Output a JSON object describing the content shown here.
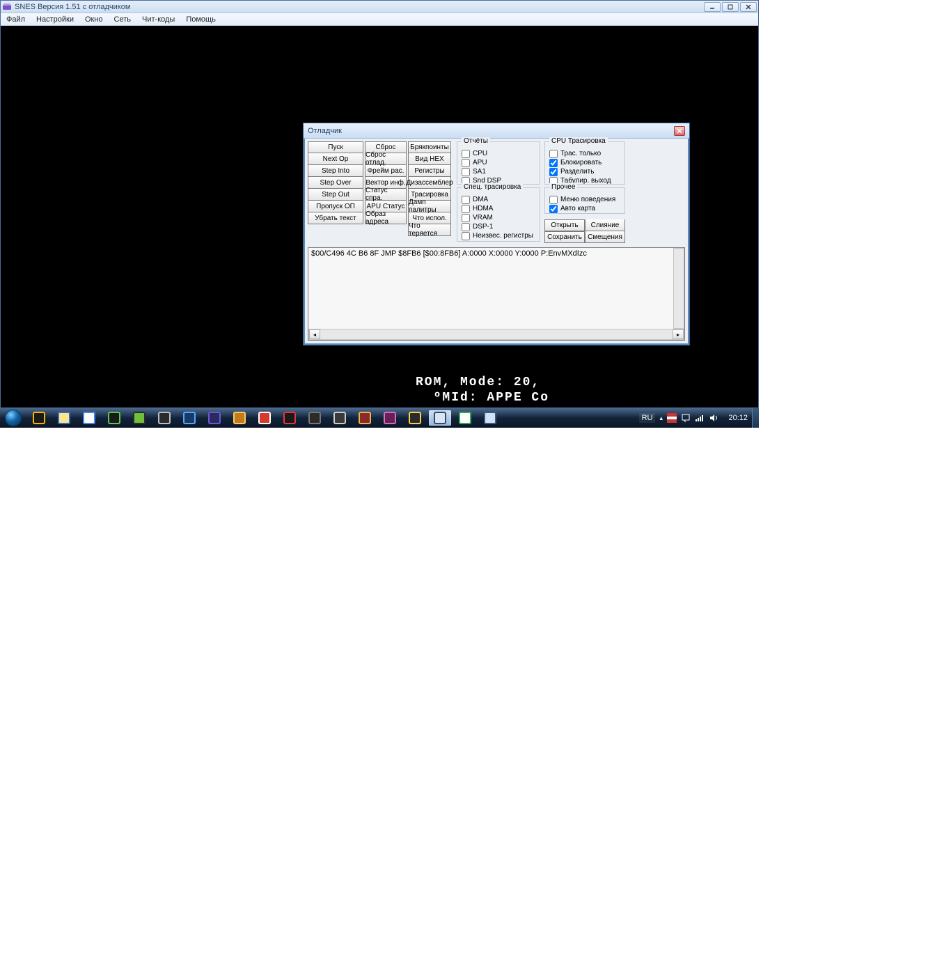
{
  "app": {
    "title": "SNES Версия 1.51 с отладчиком",
    "menu": [
      "Файл",
      "Настройки",
      "Окно",
      "Сеть",
      "Чит-коды",
      "Помощь"
    ]
  },
  "rom_overlay": "ROM, Mode: 20,\n  ºMId: APPE Co",
  "debugger": {
    "title": "Отладчик",
    "col1": [
      "Пуск",
      "Next Op",
      "Step Into",
      "Step Over",
      "Step Out",
      "Пропуск ОП",
      "Убрать текст"
    ],
    "col2": [
      "Сброс",
      "Сброс отлад.",
      "Фрейм рас.",
      "Вектор инф.",
      "Статус спра.",
      "APU Статус",
      "Образ адреса"
    ],
    "col3": [
      "Брякпоинты",
      "Вид HEX",
      "Регистры",
      "Дизассемблер",
      "Трасировка",
      "Дамп палитры",
      "Что испол.",
      "Что теряется"
    ],
    "groups": {
      "reports": {
        "legend": "Отчёты",
        "items": [
          {
            "label": "CPU",
            "checked": false
          },
          {
            "label": "APU",
            "checked": false
          },
          {
            "label": "SA1",
            "checked": false
          },
          {
            "label": "Snd DSP",
            "checked": false
          }
        ]
      },
      "spec": {
        "legend": "Спец. трасировка",
        "items": [
          {
            "label": "DMA",
            "checked": false
          },
          {
            "label": "HDMA",
            "checked": false
          },
          {
            "label": "VRAM",
            "checked": false
          },
          {
            "label": "DSP-1",
            "checked": false
          },
          {
            "label": "Неизвес. регистры",
            "checked": false
          }
        ]
      },
      "cpu": {
        "legend": "CPU Трасировка",
        "items": [
          {
            "label": "Трас. только",
            "checked": false
          },
          {
            "label": "Блокировать",
            "checked": true
          },
          {
            "label": "Разделить",
            "checked": true
          },
          {
            "label": "Табулир. выход",
            "checked": false
          }
        ]
      },
      "other": {
        "legend": "Прочее",
        "items": [
          {
            "label": "Меню поведения",
            "checked": false
          },
          {
            "label": "Авто карта",
            "checked": true
          }
        ]
      }
    },
    "file_buttons": {
      "row1": [
        "Открыть",
        "Слияние"
      ],
      "row2": [
        "Сохранить",
        "Смещения"
      ]
    },
    "trace_line": "$00/C496 4C B6 8F    JMP $8FB6   [$00:8FB6]   A:0000 X:0000 Y:0000 P:EnvMXdIzc"
  },
  "taskbar": {
    "icons": [
      {
        "name": "aimp-icon",
        "bg": "#1a1a1a",
        "fg": "#ffb400"
      },
      {
        "name": "explorer-icon",
        "bg": "#ffe28a",
        "fg": "#2a6fcf"
      },
      {
        "name": "chrome-icon",
        "bg": "#ffffff",
        "fg": "#4285f4"
      },
      {
        "name": "dc-icon",
        "bg": "#1a1a1a",
        "fg": "#5fc74e"
      },
      {
        "name": "game-icon",
        "bg": "#6fbf3c",
        "fg": "#2b2b2b"
      },
      {
        "name": "foobar-icon",
        "bg": "#2b2b2b",
        "fg": "#bdbdbd"
      },
      {
        "name": "photoshop-icon",
        "bg": "#1a3a66",
        "fg": "#52a7ff"
      },
      {
        "name": "emu-icon",
        "bg": "#2a2a5e",
        "fg": "#6a58d4"
      },
      {
        "name": "emu2-icon",
        "bg": "#c27a1c",
        "fg": "#f5c96a"
      },
      {
        "name": "launchy-icon",
        "bg": "#d53a2a",
        "fg": "#ffffff"
      },
      {
        "name": "opera-icon",
        "bg": "#1a1a1a",
        "fg": "#e6383c"
      },
      {
        "name": "gamepad-icon",
        "bg": "#2b2b2b",
        "fg": "#777"
      },
      {
        "name": "app-icon",
        "bg": "#3a3a3a",
        "fg": "#ccc"
      },
      {
        "name": "book-icon",
        "bg": "#8a2a2a",
        "fg": "#e6b84a"
      },
      {
        "name": "dict-icon",
        "bg": "#6a1f5a",
        "fg": "#cf75b8"
      },
      {
        "name": "python-icon",
        "bg": "#2b2b2b",
        "fg": "#f7d34a"
      },
      {
        "name": "snes-icon",
        "bg": "#d7e5f5",
        "fg": "#334a66",
        "active": true
      },
      {
        "name": "utorrent-icon",
        "bg": "#ffffff",
        "fg": "#2fa84f"
      },
      {
        "name": "notepad-icon",
        "bg": "#cfe3f8",
        "fg": "#3a5a7d"
      }
    ],
    "lang": "RU",
    "clock": "20:12"
  }
}
